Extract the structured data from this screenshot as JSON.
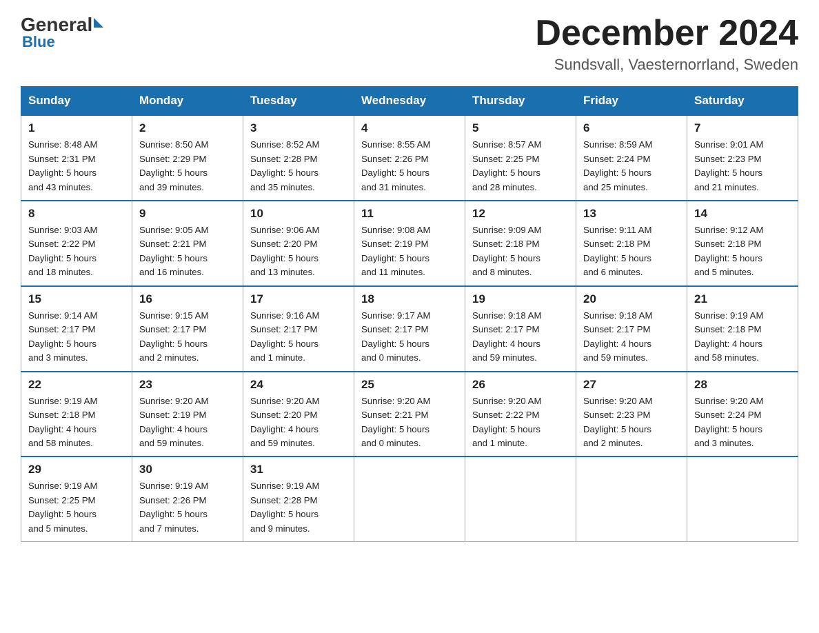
{
  "header": {
    "logo_general": "General",
    "logo_blue": "Blue",
    "month_title": "December 2024",
    "location": "Sundsvall, Vaesternorrland, Sweden"
  },
  "weekdays": [
    "Sunday",
    "Monday",
    "Tuesday",
    "Wednesday",
    "Thursday",
    "Friday",
    "Saturday"
  ],
  "weeks": [
    [
      {
        "day": "1",
        "info": "Sunrise: 8:48 AM\nSunset: 2:31 PM\nDaylight: 5 hours\nand 43 minutes."
      },
      {
        "day": "2",
        "info": "Sunrise: 8:50 AM\nSunset: 2:29 PM\nDaylight: 5 hours\nand 39 minutes."
      },
      {
        "day": "3",
        "info": "Sunrise: 8:52 AM\nSunset: 2:28 PM\nDaylight: 5 hours\nand 35 minutes."
      },
      {
        "day": "4",
        "info": "Sunrise: 8:55 AM\nSunset: 2:26 PM\nDaylight: 5 hours\nand 31 minutes."
      },
      {
        "day": "5",
        "info": "Sunrise: 8:57 AM\nSunset: 2:25 PM\nDaylight: 5 hours\nand 28 minutes."
      },
      {
        "day": "6",
        "info": "Sunrise: 8:59 AM\nSunset: 2:24 PM\nDaylight: 5 hours\nand 25 minutes."
      },
      {
        "day": "7",
        "info": "Sunrise: 9:01 AM\nSunset: 2:23 PM\nDaylight: 5 hours\nand 21 minutes."
      }
    ],
    [
      {
        "day": "8",
        "info": "Sunrise: 9:03 AM\nSunset: 2:22 PM\nDaylight: 5 hours\nand 18 minutes."
      },
      {
        "day": "9",
        "info": "Sunrise: 9:05 AM\nSunset: 2:21 PM\nDaylight: 5 hours\nand 16 minutes."
      },
      {
        "day": "10",
        "info": "Sunrise: 9:06 AM\nSunset: 2:20 PM\nDaylight: 5 hours\nand 13 minutes."
      },
      {
        "day": "11",
        "info": "Sunrise: 9:08 AM\nSunset: 2:19 PM\nDaylight: 5 hours\nand 11 minutes."
      },
      {
        "day": "12",
        "info": "Sunrise: 9:09 AM\nSunset: 2:18 PM\nDaylight: 5 hours\nand 8 minutes."
      },
      {
        "day": "13",
        "info": "Sunrise: 9:11 AM\nSunset: 2:18 PM\nDaylight: 5 hours\nand 6 minutes."
      },
      {
        "day": "14",
        "info": "Sunrise: 9:12 AM\nSunset: 2:18 PM\nDaylight: 5 hours\nand 5 minutes."
      }
    ],
    [
      {
        "day": "15",
        "info": "Sunrise: 9:14 AM\nSunset: 2:17 PM\nDaylight: 5 hours\nand 3 minutes."
      },
      {
        "day": "16",
        "info": "Sunrise: 9:15 AM\nSunset: 2:17 PM\nDaylight: 5 hours\nand 2 minutes."
      },
      {
        "day": "17",
        "info": "Sunrise: 9:16 AM\nSunset: 2:17 PM\nDaylight: 5 hours\nand 1 minute."
      },
      {
        "day": "18",
        "info": "Sunrise: 9:17 AM\nSunset: 2:17 PM\nDaylight: 5 hours\nand 0 minutes."
      },
      {
        "day": "19",
        "info": "Sunrise: 9:18 AM\nSunset: 2:17 PM\nDaylight: 4 hours\nand 59 minutes."
      },
      {
        "day": "20",
        "info": "Sunrise: 9:18 AM\nSunset: 2:17 PM\nDaylight: 4 hours\nand 59 minutes."
      },
      {
        "day": "21",
        "info": "Sunrise: 9:19 AM\nSunset: 2:18 PM\nDaylight: 4 hours\nand 58 minutes."
      }
    ],
    [
      {
        "day": "22",
        "info": "Sunrise: 9:19 AM\nSunset: 2:18 PM\nDaylight: 4 hours\nand 58 minutes."
      },
      {
        "day": "23",
        "info": "Sunrise: 9:20 AM\nSunset: 2:19 PM\nDaylight: 4 hours\nand 59 minutes."
      },
      {
        "day": "24",
        "info": "Sunrise: 9:20 AM\nSunset: 2:20 PM\nDaylight: 4 hours\nand 59 minutes."
      },
      {
        "day": "25",
        "info": "Sunrise: 9:20 AM\nSunset: 2:21 PM\nDaylight: 5 hours\nand 0 minutes."
      },
      {
        "day": "26",
        "info": "Sunrise: 9:20 AM\nSunset: 2:22 PM\nDaylight: 5 hours\nand 1 minute."
      },
      {
        "day": "27",
        "info": "Sunrise: 9:20 AM\nSunset: 2:23 PM\nDaylight: 5 hours\nand 2 minutes."
      },
      {
        "day": "28",
        "info": "Sunrise: 9:20 AM\nSunset: 2:24 PM\nDaylight: 5 hours\nand 3 minutes."
      }
    ],
    [
      {
        "day": "29",
        "info": "Sunrise: 9:19 AM\nSunset: 2:25 PM\nDaylight: 5 hours\nand 5 minutes."
      },
      {
        "day": "30",
        "info": "Sunrise: 9:19 AM\nSunset: 2:26 PM\nDaylight: 5 hours\nand 7 minutes."
      },
      {
        "day": "31",
        "info": "Sunrise: 9:19 AM\nSunset: 2:28 PM\nDaylight: 5 hours\nand 9 minutes."
      },
      {
        "day": "",
        "info": ""
      },
      {
        "day": "",
        "info": ""
      },
      {
        "day": "",
        "info": ""
      },
      {
        "day": "",
        "info": ""
      }
    ]
  ]
}
